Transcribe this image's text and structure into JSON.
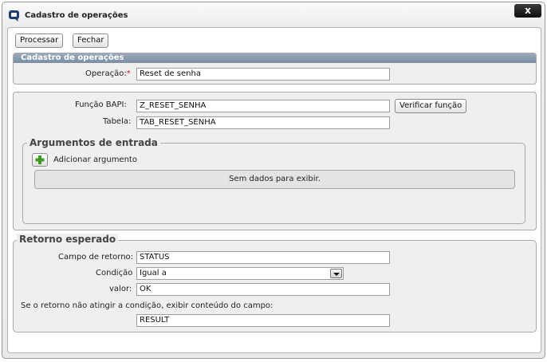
{
  "window": {
    "title": "Cadastro de operações",
    "close_label": "x"
  },
  "toolbar": {
    "process_label": "Processar",
    "close_label": "Fechar"
  },
  "operation_section": {
    "header": "Cadastro de operações",
    "operation_label": "Operação:",
    "required_mark": "*",
    "operation_value": "Reset de senha"
  },
  "bapi_section": {
    "function_label": "Função BAPI:",
    "function_value": "Z_RESET_SENHA",
    "verify_label": "Verificar função",
    "table_label": "Tabela:",
    "table_value": "TAB_RESET_SENHA"
  },
  "arguments": {
    "legend": "Argumentos de entrada",
    "add_label": "Adicionar argumento",
    "empty_text": "Sem dados para exibir."
  },
  "return_section": {
    "legend": "Retorno esperado",
    "field_label": "Campo de retorno:",
    "field_value": "STATUS",
    "condition_label": "Condição",
    "condition_value": "Igual a",
    "value_label": "valor:",
    "value_value": "OK",
    "fallback_label": "Se o retorno não atingir a condição, exibir conteúdo do campo:",
    "fallback_value": "RESULT"
  },
  "colors": {
    "header_bar": "#8a9db1",
    "close_button": "#1a1a1a",
    "required": "#cc1b1b",
    "add_icon_plus": "#3a9e1e"
  }
}
